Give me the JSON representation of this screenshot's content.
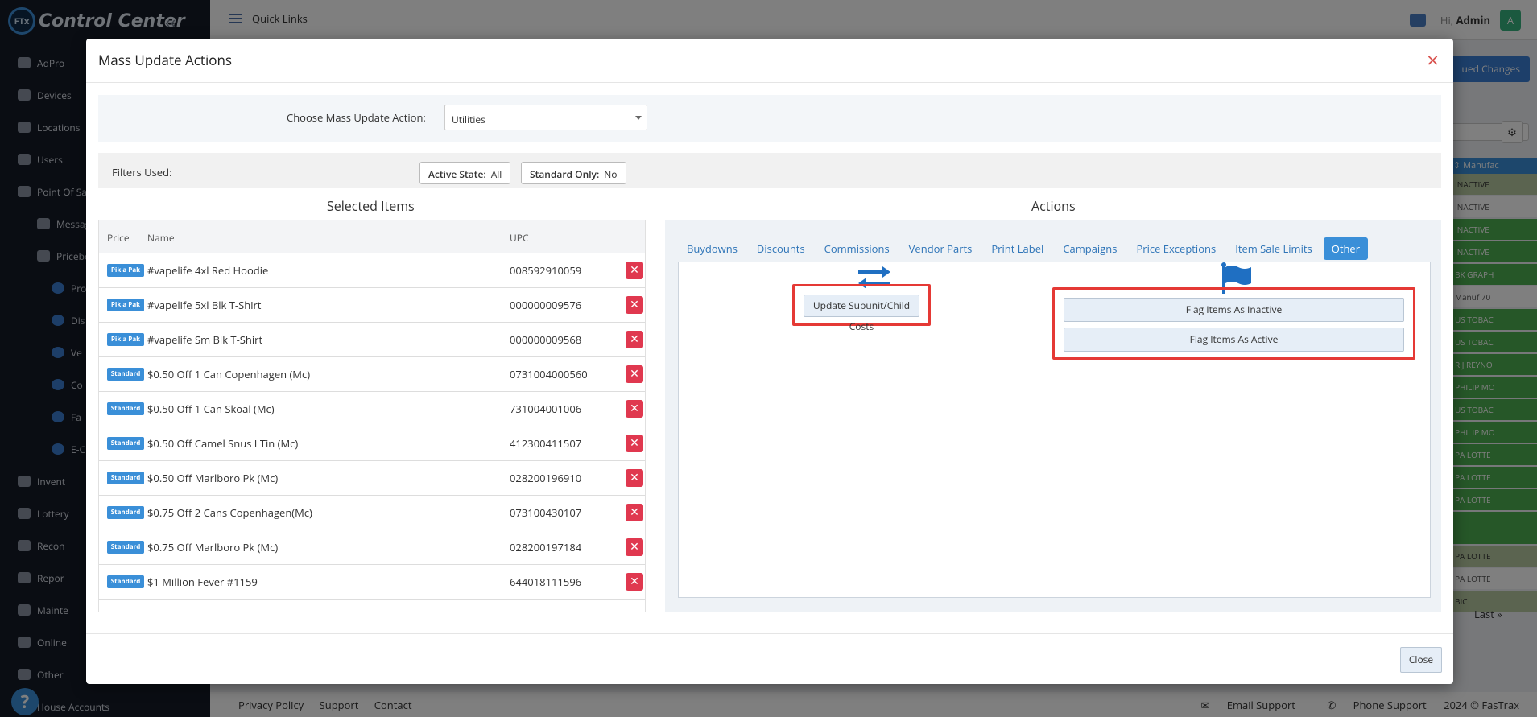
{
  "app": {
    "title": "Control Center",
    "logo_badge": "FTx"
  },
  "sidebar": {
    "items": [
      {
        "label": "AdPro",
        "level": 0
      },
      {
        "label": "Devices",
        "level": 0
      },
      {
        "label": "Locations",
        "level": 0
      },
      {
        "label": "Users",
        "level": 0
      },
      {
        "label": "Point Of Sal",
        "level": 0
      },
      {
        "label": "Messag",
        "level": 1
      },
      {
        "label": "Pricebo",
        "level": 1
      },
      {
        "label": "Pro",
        "level": 2
      },
      {
        "label": "Dis",
        "level": 2
      },
      {
        "label": "Ve",
        "level": 2
      },
      {
        "label": "Co",
        "level": 2
      },
      {
        "label": "Fa",
        "level": 2
      },
      {
        "label": "E-C",
        "level": 2
      },
      {
        "label": "Invent",
        "level": 0
      },
      {
        "label": "Lottery",
        "level": 0
      },
      {
        "label": "Recon",
        "level": 0
      },
      {
        "label": "Repor",
        "level": 0
      },
      {
        "label": "Mainte",
        "level": 0
      },
      {
        "label": "Online",
        "level": 0
      },
      {
        "label": "Other",
        "level": 0
      },
      {
        "label": "House Accounts",
        "level": 0
      }
    ]
  },
  "topbar": {
    "quick_links": "Quick Links",
    "greeting": "Hi,",
    "username": "Admin",
    "avatar_letter": "A"
  },
  "background": {
    "button_label": "ued Changes",
    "column_header": "Manufac",
    "cells": [
      {
        "text": "INACTIVE",
        "color": "#b7c9a0"
      },
      {
        "text": "INACTIVE",
        "color": "#ffffff"
      },
      {
        "text": "INACTIVE",
        "color": "#4caf50"
      },
      {
        "text": "INACTIVE",
        "color": "#4caf50"
      },
      {
        "text": "BK GRAPH",
        "color": "#4caf50"
      },
      {
        "text": "Manuf 70",
        "color": "#ffffff"
      },
      {
        "text": "US TOBAC",
        "color": "#4caf50"
      },
      {
        "text": "US TOBAC",
        "color": "#4caf50"
      },
      {
        "text": "R J REYNO",
        "color": "#4caf50"
      },
      {
        "text": "PHILIP MO",
        "color": "#4caf50"
      },
      {
        "text": "US TOBAC",
        "color": "#4caf50"
      },
      {
        "text": "PHILIP MO",
        "color": "#4caf50"
      },
      {
        "text": "PA LOTTE",
        "color": "#4caf50"
      },
      {
        "text": "PA LOTTE",
        "color": "#4caf50"
      },
      {
        "text": "PA LOTTE",
        "color": "#4caf50"
      },
      {
        "text": "",
        "color": "#4caf50"
      },
      {
        "text": "PA LOTTE",
        "color": "#b7c9a0"
      },
      {
        "text": "PA LOTTE",
        "color": "#ffffff"
      },
      {
        "text": "BIC",
        "color": "#b7c9a0"
      }
    ],
    "pager_last": "Last »"
  },
  "footer": {
    "links": [
      "Privacy Policy",
      "Support",
      "Contact"
    ],
    "email": "Email Support",
    "phone": "Phone Support",
    "copyright": "2024 © FasTrax"
  },
  "modal": {
    "title": "Mass Update Actions",
    "choose_label": "Choose Mass Update Action:",
    "choose_value": "Utilities",
    "filters_label": "Filters Used:",
    "filters": [
      {
        "key": "Active State:",
        "value": "All"
      },
      {
        "key": "Standard Only:",
        "value": "No"
      }
    ],
    "selected_title": "Selected Items",
    "actions_title": "Actions",
    "columns": {
      "price": "Price",
      "name": "Name",
      "upc": "UPC"
    },
    "items": [
      {
        "badge": "Pik a Pak",
        "name": "#vapelife 4xl Red Hoodie",
        "upc": "008592910059"
      },
      {
        "badge": "Pik a Pak",
        "name": "#vapelife 5xl Blk T-Shirt",
        "upc": "000000009576"
      },
      {
        "badge": "Pik a Pak",
        "name": "#vapelife Sm Blk T-Shirt",
        "upc": "000000009568"
      },
      {
        "badge": "Standard",
        "name": "$0.50 Off 1 Can Copenhagen (Mc)",
        "upc": "0731004000560"
      },
      {
        "badge": "Standard",
        "name": "$0.50 Off 1 Can Skoal (Mc)",
        "upc": "731004001006"
      },
      {
        "badge": "Standard",
        "name": "$0.50 Off Camel Snus I Tin (Mc)",
        "upc": "412300411507"
      },
      {
        "badge": "Standard",
        "name": "$0.50 Off Marlboro Pk (Mc)",
        "upc": "028200196910"
      },
      {
        "badge": "Standard",
        "name": "$0.75 Off 2 Cans Copenhagen(Mc)",
        "upc": "073100430107"
      },
      {
        "badge": "Standard",
        "name": "$0.75 Off Marlboro Pk (Mc)",
        "upc": "028200197184"
      },
      {
        "badge": "Standard",
        "name": "$1 Million Fever #1159",
        "upc": "644018111596"
      }
    ],
    "tabs": [
      "Buydowns",
      "Discounts",
      "Commissions",
      "Vendor Parts",
      "Print Label",
      "Campaigns",
      "Price Exceptions",
      "Item Sale Limits",
      "Other"
    ],
    "active_tab": "Other",
    "buttons": {
      "update_costs": "Update Subunit/Child Costs",
      "flag_inactive": "Flag Items As Inactive",
      "flag_active": "Flag Items As Active"
    },
    "close_label": "Close"
  }
}
